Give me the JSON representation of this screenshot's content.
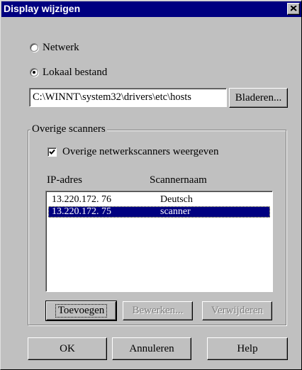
{
  "window": {
    "title": "Display wijzigen"
  },
  "source": {
    "options": [
      {
        "label": "Netwerk",
        "checked": false
      },
      {
        "label": "Lokaal bestand",
        "checked": true
      }
    ],
    "file_path": "C:\\WINNT\\system32\\drivers\\etc\\hosts",
    "browse_label": "Bladeren..."
  },
  "scanners": {
    "group_title": "Overige scanners",
    "show_checkbox_label": "Overige netwerkscanners weergeven",
    "show_checked": true,
    "columns": [
      "IP-adres",
      "Scannernaam"
    ],
    "rows": [
      {
        "ip": "13.220.172. 76",
        "name": "Deutsch",
        "selected": false
      },
      {
        "ip": "13.220.172. 75",
        "name": "scanner",
        "selected": true
      }
    ],
    "buttons": {
      "add": "Toevoegen",
      "edit": "Bewerken...",
      "remove": "Verwijderen"
    }
  },
  "footer": {
    "ok": "OK",
    "cancel": "Annuleren",
    "help": "Help"
  }
}
